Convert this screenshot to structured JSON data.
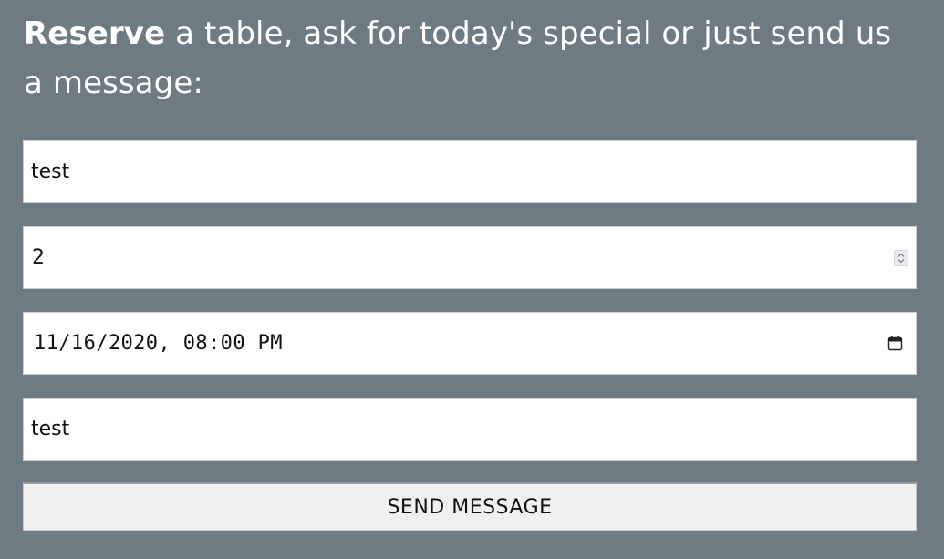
{
  "heading": {
    "bold": "Reserve",
    "rest": " a table, ask for today's special or just send us a message:"
  },
  "form": {
    "name_value": "test",
    "people_value": "2",
    "datetime_value": "11/16/2020, 08:00 PM",
    "message_value": "test",
    "submit_label": "SEND MESSAGE"
  },
  "icons": {
    "number_spinner": "spinner-arrows-icon",
    "date_picker": "calendar-icon"
  },
  "colors": {
    "background": "#6e7b82",
    "field_background": "#ffffff",
    "button_background": "#f0f0f0",
    "heading_text": "#ffffff"
  }
}
